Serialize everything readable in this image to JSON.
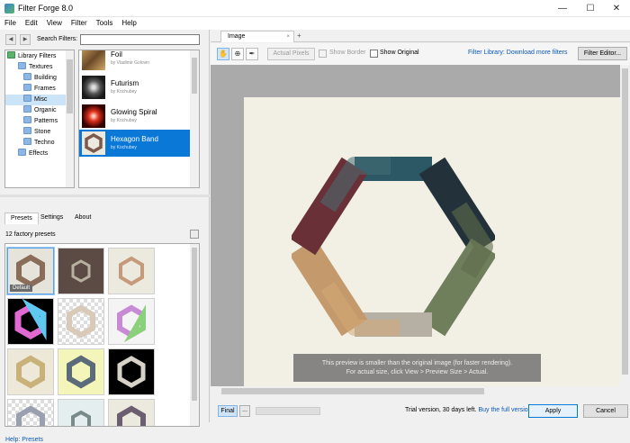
{
  "window": {
    "title": "Filter Forge 8.0"
  },
  "menu": [
    "File",
    "Edit",
    "View",
    "Filter",
    "Tools",
    "Help"
  ],
  "search": {
    "label": "Search Filters:",
    "value": ""
  },
  "tree": {
    "root": "Library Filters",
    "items": [
      {
        "label": "Textures",
        "level": 1
      },
      {
        "label": "Building",
        "level": 2
      },
      {
        "label": "Frames",
        "level": 2
      },
      {
        "label": "Misc",
        "level": 2,
        "selected": true
      },
      {
        "label": "Organic",
        "level": 2
      },
      {
        "label": "Patterns",
        "level": 2
      },
      {
        "label": "Stone",
        "level": 2
      },
      {
        "label": "Techno",
        "level": 2
      },
      {
        "label": "Effects",
        "level": 1
      }
    ]
  },
  "filters": [
    {
      "name": "Foil",
      "author": "by Vladimir Golovin"
    },
    {
      "name": "Futurism",
      "author": "by Kochubey"
    },
    {
      "name": "Glowing Spiral",
      "author": "by Kochubey"
    },
    {
      "name": "Hexagon Band",
      "author": "by Kochubey",
      "selected": true
    }
  ],
  "preset_tabs": [
    "Presets",
    "Settings",
    "About"
  ],
  "preset_count": "12 factory presets",
  "presets": {
    "default_label": "Default",
    "count": 12
  },
  "help": "Help: Presets",
  "doc_tab": {
    "label": "Image"
  },
  "toolbar": {
    "actual_pixels": "Actual Pixels",
    "show_border": "Show Border",
    "show_original": "Show Original",
    "library_link": "Filter Library: Download more filters",
    "filter_editor": "Filter Editor..."
  },
  "preview_notice": {
    "line1": "This preview is smaller than the original image (for faster rendering).",
    "line2": "For actual size, click View > Preview Size > Actual."
  },
  "status": {
    "final": "Final",
    "more": "...",
    "trial_text": "Trial version, 30 days left.",
    "buy_link": "Buy the full version!",
    "apply": "Apply",
    "cancel": "Cancel"
  },
  "colors": {
    "accent": "#0a78d7",
    "link": "#0b57b4"
  }
}
